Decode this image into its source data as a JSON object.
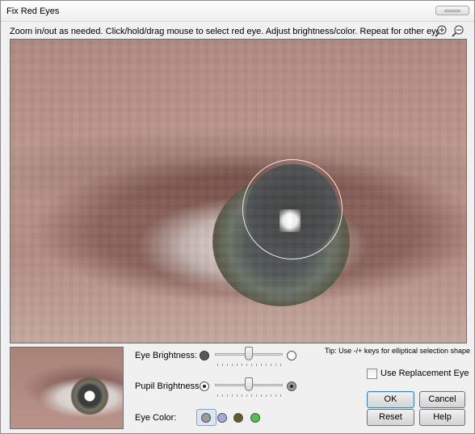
{
  "window": {
    "title": "Fix Red Eyes"
  },
  "instructions": "Zoom in/out as needed. Click/hold/drag mouse to select red eye. Adjust brightness/color. Repeat for other eye.",
  "toolbar": {
    "zoom_in_icon": "zoom-in-icon",
    "zoom_out_icon": "zoom-out-icon"
  },
  "tip": "Tip: Use -/+ keys for elliptical selection shape",
  "controls": {
    "eye_brightness": {
      "label": "Eye Brightness:",
      "value_percent": 50
    },
    "pupil_brightness": {
      "label": "Pupil Brightness:",
      "value_percent": 50
    },
    "eye_color": {
      "label": "Eye Color:",
      "options": [
        "#9a9a9a",
        "#a7a7e8",
        "#5e5a2a",
        "#4ec24e"
      ],
      "selected_index": 0
    }
  },
  "replacement": {
    "label": "Use Replacement Eye",
    "checked": false
  },
  "buttons": {
    "ok": "OK",
    "cancel": "Cancel",
    "reset": "Reset",
    "help": "Help"
  }
}
